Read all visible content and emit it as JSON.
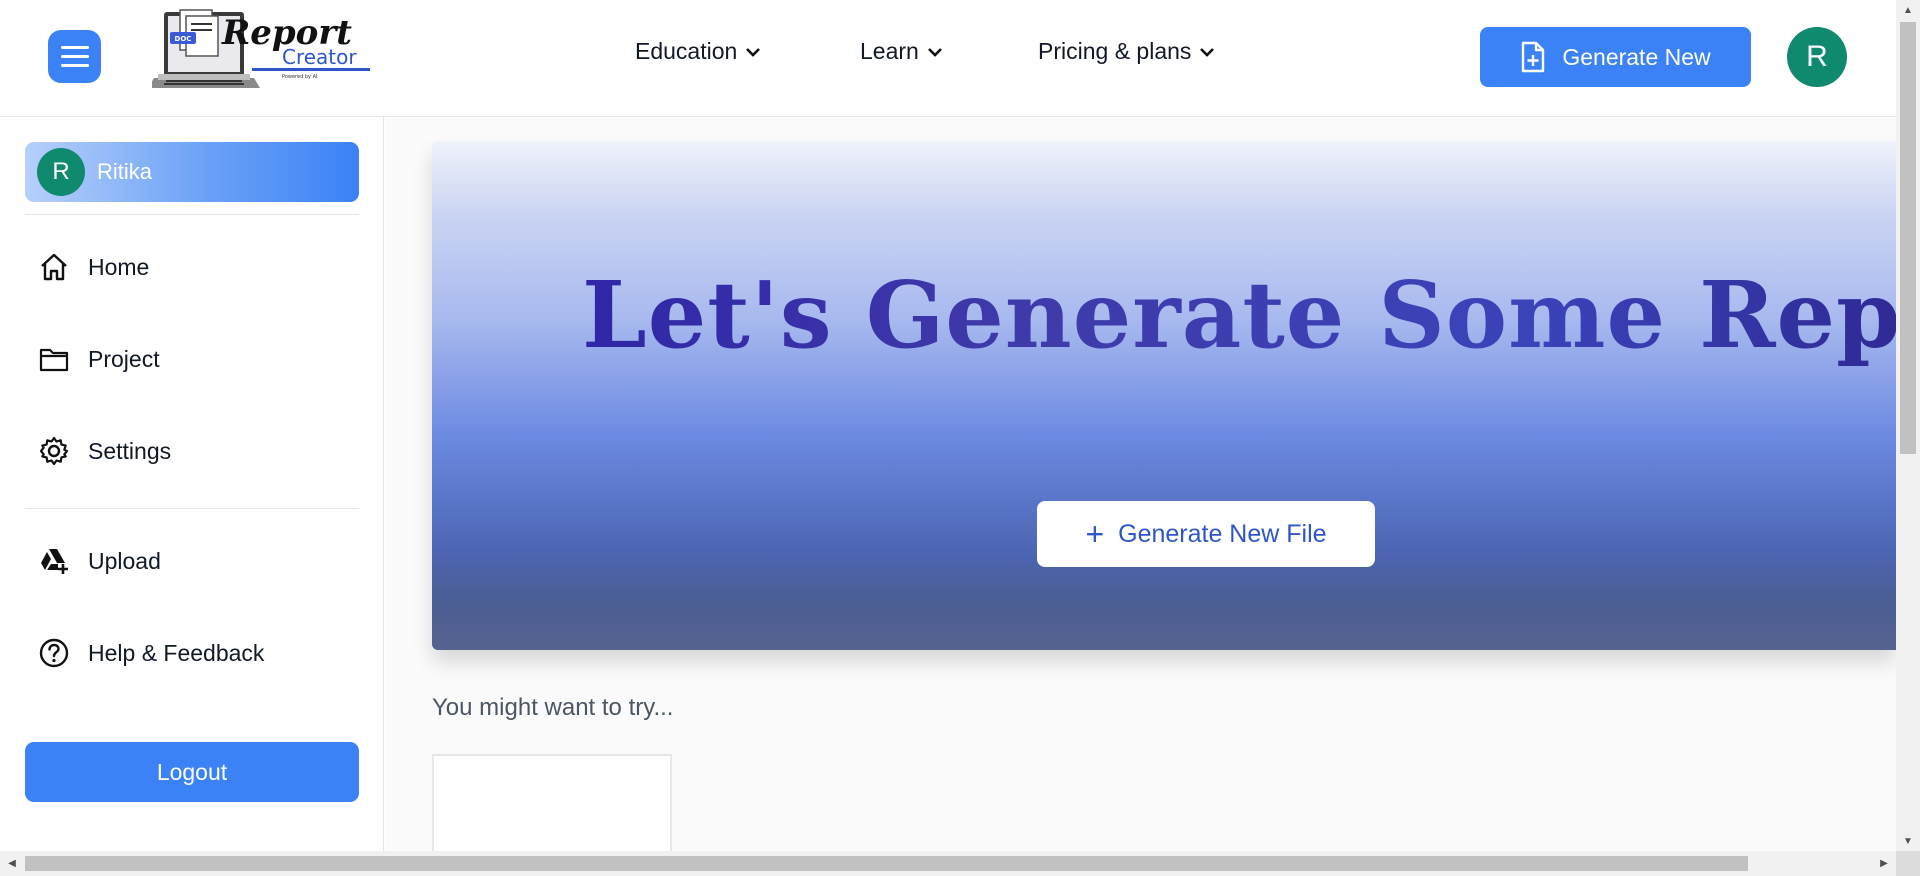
{
  "header": {
    "logo": {
      "word1": "Report",
      "word2": "Creator",
      "doc_tag": "DOC",
      "tagline": "Powered by AI"
    },
    "nav": [
      {
        "label": "Education"
      },
      {
        "label": "Learn"
      },
      {
        "label": "Pricing & plans"
      }
    ],
    "generate_label": "Generate New",
    "avatar_letter": "R"
  },
  "sidebar": {
    "user": {
      "initial": "R",
      "name": "Ritika"
    },
    "items": [
      {
        "label": "Home",
        "icon": "home-icon"
      },
      {
        "label": "Project",
        "icon": "folder-icon"
      },
      {
        "label": "Settings",
        "icon": "gear-icon"
      },
      {
        "label": "Upload",
        "icon": "drive-add-icon"
      },
      {
        "label": "Help & Feedback",
        "icon": "help-icon"
      }
    ],
    "logout_label": "Logout"
  },
  "main": {
    "hero_title": "Let's Generate Some Report",
    "generate_file_label": "Generate New File",
    "try_title": "You might want to try..."
  },
  "colors": {
    "primary": "#3b82f6",
    "avatar": "#0f8a6e",
    "hero_text": "#2a1fa6"
  }
}
